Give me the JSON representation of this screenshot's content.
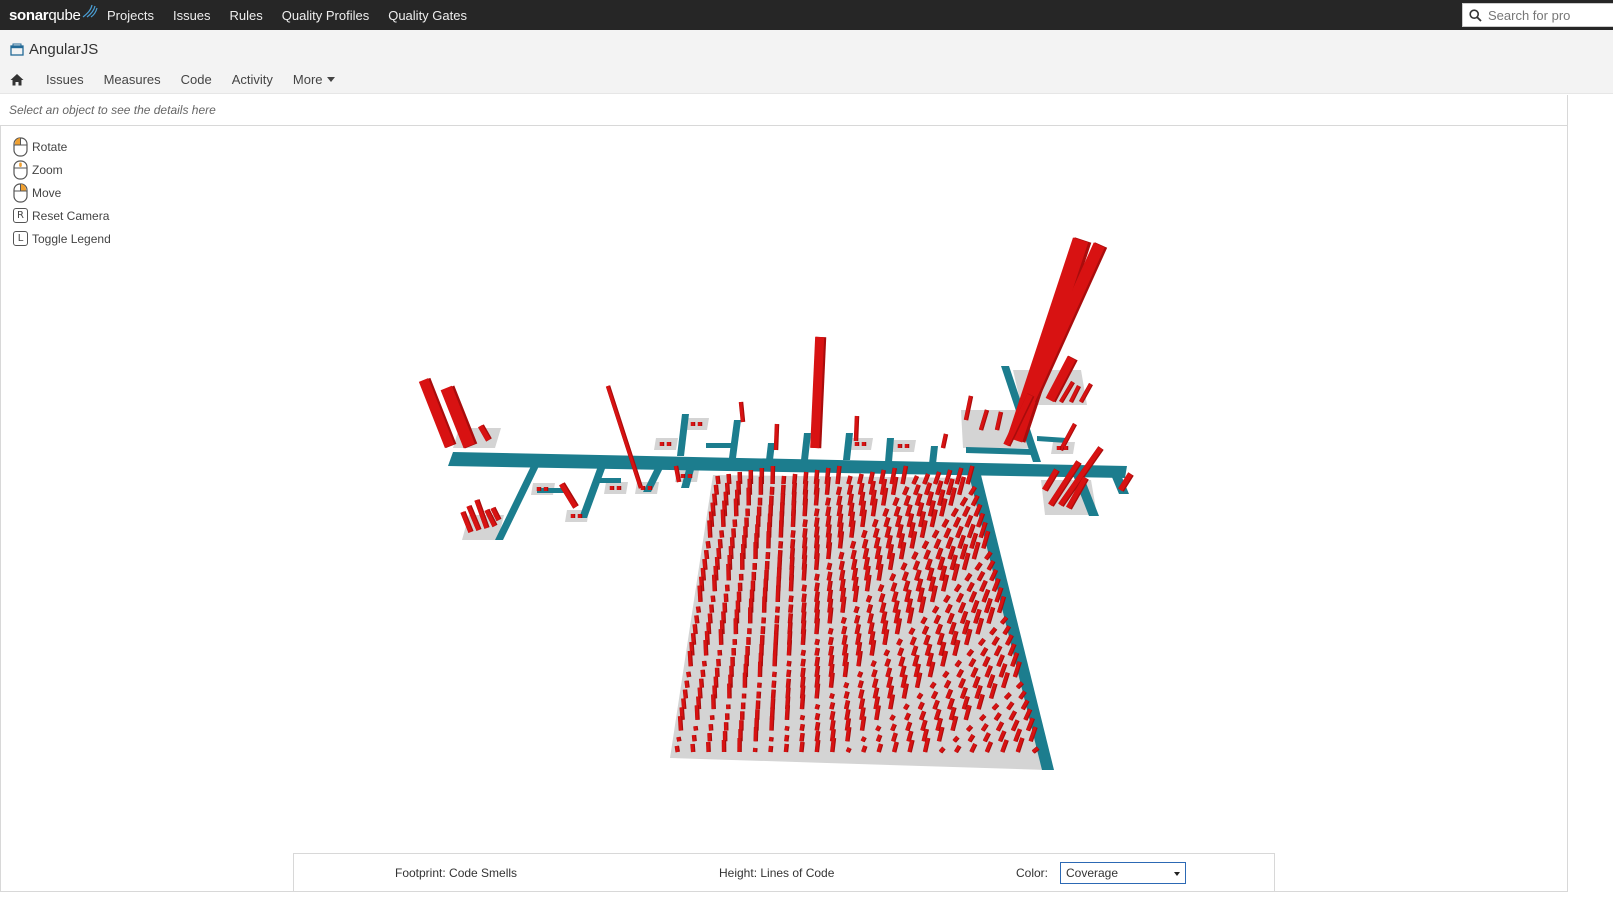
{
  "topnav": {
    "logo_bold": "sonar",
    "logo_rest": "qube",
    "items": [
      "Projects",
      "Issues",
      "Rules",
      "Quality Profiles",
      "Quality Gates"
    ],
    "search_placeholder": "Search for pro"
  },
  "project": {
    "name": "AngularJS",
    "nav": [
      "Issues",
      "Measures",
      "Code",
      "Activity"
    ],
    "more_label": "More"
  },
  "infobar": {
    "text": "Select an object to see the details here"
  },
  "controls": [
    {
      "key": "mouse-left",
      "label": "Rotate"
    },
    {
      "key": "mouse-wheel",
      "label": "Zoom"
    },
    {
      "key": "mouse-right",
      "label": "Move"
    },
    {
      "key": "R",
      "label": "Reset Camera"
    },
    {
      "key": "L",
      "label": "Toggle Legend"
    }
  ],
  "legend": {
    "footprint": "Footprint: Code Smells",
    "height": "Height: Lines of Code",
    "color_label": "Color:",
    "color_value": "Coverage"
  },
  "colors": {
    "street": "#1c7d8e",
    "building": "#d81212",
    "district": "#d4d4d4",
    "topbar": "#262626",
    "select_border": "#2c69b4"
  }
}
